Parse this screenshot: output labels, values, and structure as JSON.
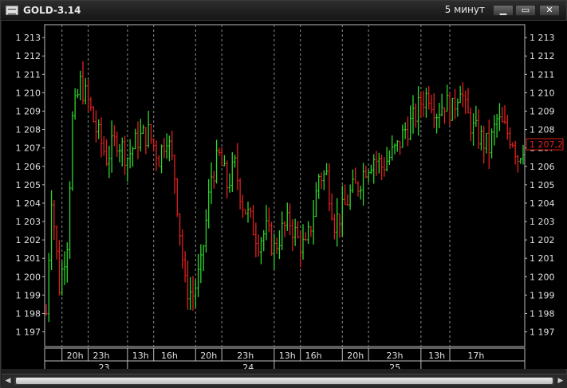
{
  "window": {
    "title": "GOLD-3.14",
    "timeframe": "5 минут",
    "buttons": {
      "minimize": "▁",
      "maximize": "▭",
      "close": "✕"
    },
    "icons": {
      "app": "chart-app-icon",
      "minimize": "minimize-icon",
      "maximize": "maximize-icon",
      "close": "close-icon"
    }
  },
  "chart_data": {
    "type": "bar",
    "subtype": "ohlc",
    "y_ticks": [
      "1 213",
      "1 212",
      "1 211",
      "1 210",
      "1 209",
      "1 208",
      "1 207",
      "1 206",
      "1 205",
      "1 204",
      "1 203",
      "1 202",
      "1 201",
      "1 200",
      "1 199",
      "1 198",
      "1 197"
    ],
    "ylim": [
      1196.2,
      1213.7
    ],
    "x_time_labels": [
      "20h",
      "23h",
      "13h",
      "16h",
      "20h",
      "23h",
      "13h",
      "16h",
      "20h",
      "23h",
      "13h",
      "17h"
    ],
    "x_date_labels": [
      "23",
      "24",
      "25"
    ],
    "current_price": "1 207,2",
    "colors": {
      "up": "#2fd52f",
      "down": "#e02020",
      "grid": "#8a8a8a",
      "background": "#000000",
      "text": "#e0e0e0",
      "price_tag_border": "#e02020"
    },
    "grid": "vertical-dashed",
    "price_path": [
      [
        0,
        1198.0
      ],
      [
        2,
        1204.5
      ],
      [
        5,
        1199.5
      ],
      [
        8,
        1202.0
      ],
      [
        10,
        1208.5
      ],
      [
        13,
        1210.5
      ],
      [
        16,
        1209.5
      ],
      [
        19,
        1208.0
      ],
      [
        23,
        1206.5
      ],
      [
        27,
        1207.5
      ],
      [
        31,
        1206.5
      ],
      [
        35,
        1207.5
      ],
      [
        39,
        1207.8
      ],
      [
        43,
        1206.5
      ],
      [
        46,
        1207.8
      ],
      [
        49,
        1205.5
      ],
      [
        51,
        1202.5
      ],
      [
        53,
        1199.5
      ],
      [
        56,
        1199.0
      ],
      [
        59,
        1200.5
      ],
      [
        63,
        1205.5
      ],
      [
        66,
        1206.5
      ],
      [
        69,
        1205.0
      ],
      [
        72,
        1206.0
      ],
      [
        75,
        1204.0
      ],
      [
        78,
        1203.0
      ],
      [
        81,
        1202.0
      ],
      [
        84,
        1202.5
      ],
      [
        87,
        1201.5
      ],
      [
        90,
        1202.5
      ],
      [
        93,
        1203.0
      ],
      [
        96,
        1202.0
      ],
      [
        99,
        1201.5
      ],
      [
        102,
        1203.5
      ],
      [
        104,
        1205.5
      ],
      [
        107,
        1205.5
      ],
      [
        110,
        1203.0
      ],
      [
        113,
        1203.5
      ],
      [
        116,
        1204.5
      ],
      [
        119,
        1205.0
      ],
      [
        122,
        1206.0
      ],
      [
        125,
        1206.5
      ],
      [
        128,
        1206.0
      ],
      [
        131,
        1206.5
      ],
      [
        134,
        1207.0
      ],
      [
        137,
        1208.0
      ],
      [
        140,
        1208.5
      ],
      [
        143,
        1209.5
      ],
      [
        146,
        1210.0
      ],
      [
        149,
        1209.0
      ],
      [
        152,
        1209.5
      ],
      [
        155,
        1209.0
      ],
      [
        158,
        1210.5
      ],
      [
        160,
        1209.0
      ],
      [
        163,
        1208.0
      ],
      [
        166,
        1207.5
      ],
      [
        169,
        1207.0
      ],
      [
        172,
        1208.5
      ],
      [
        175,
        1208.0
      ],
      [
        178,
        1207.5
      ],
      [
        180,
        1206.5
      ],
      [
        182,
        1207.2
      ]
    ]
  }
}
